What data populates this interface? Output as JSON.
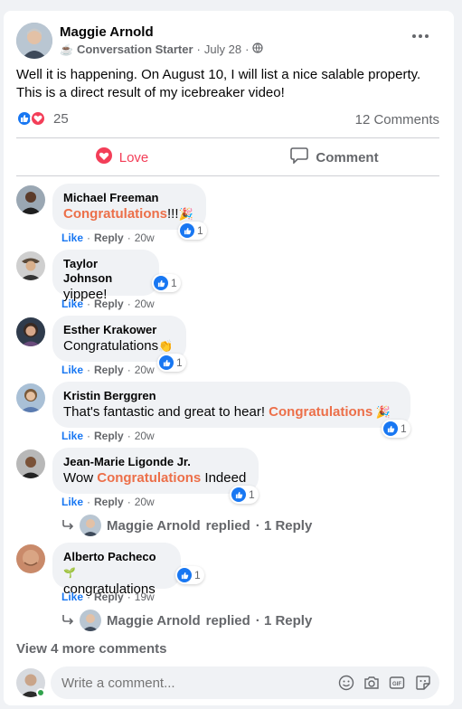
{
  "post": {
    "author": "Maggie Arnold",
    "group_tag": "Conversation Starter",
    "date": "July 28",
    "text": "Well it is happening. On August 10, I will list a nice salable property. This is a direct result of my icebreaker video!",
    "reaction_count": "25",
    "comments_count": "12 Comments"
  },
  "actions": {
    "love": "Love",
    "comment": "Comment"
  },
  "comment_actions": {
    "like": "Like",
    "reply": "Reply",
    "sep": "·"
  },
  "comments": [
    {
      "name": "Michael Freeman",
      "pre": "",
      "highlight": "Congratulations",
      "post": "!!!",
      "time": "20w",
      "reactions": "1"
    },
    {
      "name": "Taylor Johnson",
      "pre": "yippee!",
      "highlight": "",
      "post": "",
      "time": "20w",
      "reactions": "1"
    },
    {
      "name": "Esther Krakower",
      "pre": "Congratulations",
      "highlight": "",
      "post": "",
      "time": "20w",
      "reactions": "1"
    },
    {
      "name": "Kristin Berggren",
      "pre": "That's fantastic and great to hear! ",
      "highlight": "Congratulations",
      "post": "",
      "time": "20w",
      "reactions": "1"
    },
    {
      "name": "Jean-Marie Ligonde Jr.",
      "pre": "Wow ",
      "highlight": "Congratulations",
      "post": " Indeed",
      "time": "20w",
      "reactions": "1"
    },
    {
      "name": "Alberto Pacheco",
      "pre": "congratulations",
      "highlight": "",
      "post": "",
      "time": "19w",
      "reactions": "1"
    }
  ],
  "replies": [
    {
      "name": "Maggie Arnold",
      "text": "replied",
      "count": "· 1 Reply"
    },
    {
      "name": "Maggie Arnold",
      "text": "replied",
      "count": "· 1 Reply"
    }
  ],
  "view_more": "View 4 more comments",
  "composer": {
    "placeholder": "Write a comment..."
  },
  "colors": {
    "accent": "#1877f2",
    "highlight": "#ec6f49",
    "love": "#f33e58"
  }
}
